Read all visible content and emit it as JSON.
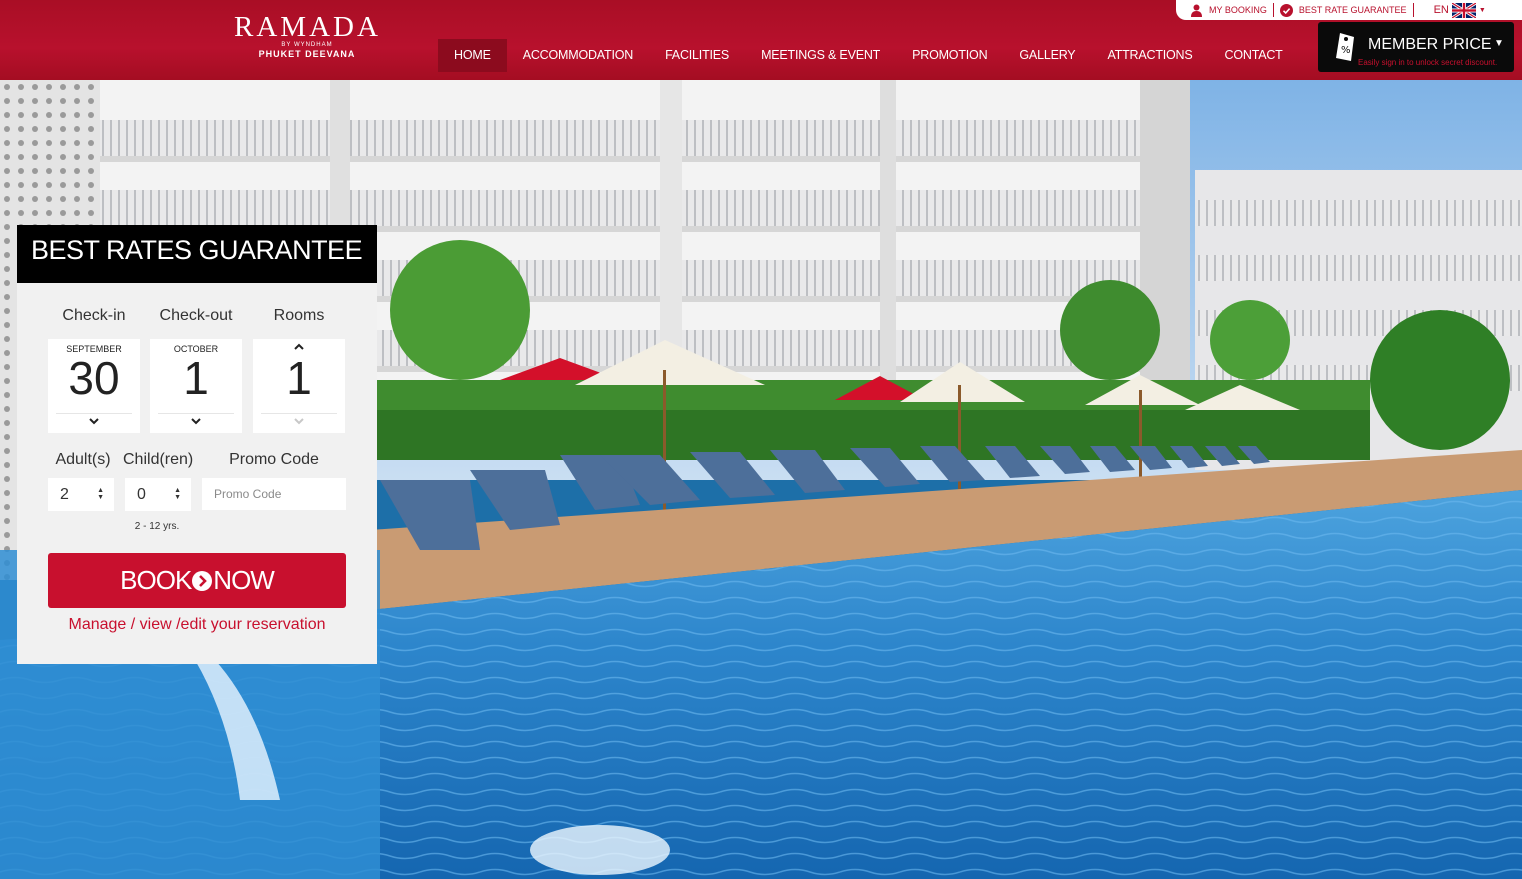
{
  "logo": {
    "brand": "RAMADA",
    "by": "BY WYNDHAM",
    "location": "PHUKET DEEVANA"
  },
  "nav": [
    "HOME",
    "ACCOMMODATION",
    "FACILITIES",
    "MEETINGS & EVENT",
    "PROMOTION",
    "GALLERY",
    "ATTRACTIONS",
    "CONTACT"
  ],
  "nav_active": "HOME",
  "topbar": {
    "my_booking": "MY BOOKING",
    "best_rate": "BEST RATE GUARANTEE",
    "lang": "EN"
  },
  "member": {
    "label": "MEMBER PRICE",
    "subtitle": "Easily sign in to unlock secret discount."
  },
  "booking": {
    "title": "BEST RATES GUARANTEE",
    "checkin_label": "Check-in",
    "checkout_label": "Check-out",
    "rooms_label": "Rooms",
    "checkin_month": "SEPTEMBER",
    "checkin_day": "30",
    "checkout_month": "OCTOBER",
    "checkout_day": "1",
    "rooms": "1",
    "adults_label": "Adult(s)",
    "children_label": "Child(ren)",
    "promo_label": "Promo Code",
    "adults": "2",
    "children": "0",
    "promo_placeholder": "Promo Code",
    "child_age_note": "2 - 12 yrs.",
    "book_left": "BOOK",
    "book_right": "NOW",
    "manage_link": "Manage / view /edit your reservation"
  },
  "colors": {
    "brand_red": "#c8102e",
    "header_red": "#b8112d",
    "black": "#000000"
  }
}
